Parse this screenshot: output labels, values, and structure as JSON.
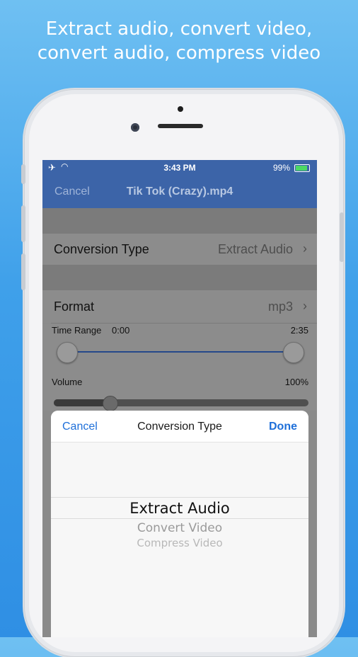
{
  "headline": {
    "line1": "Extract audio, convert video,",
    "line2": "convert audio, compress video"
  },
  "status_bar": {
    "time": "3:43 PM",
    "battery": "99%",
    "icons": [
      "airplane-icon",
      "wifi-icon",
      "battery-icon",
      "charging-icon"
    ]
  },
  "nav": {
    "cancel": "Cancel",
    "title": "Tik Tok (Crazy).mp4"
  },
  "settings": {
    "conversion_type": {
      "label": "Conversion Type",
      "value": "Extract Audio"
    },
    "format": {
      "label": "Format",
      "value": "mp3"
    },
    "time_range": {
      "label": "Time Range",
      "start": "0:00",
      "end": "2:35"
    },
    "volume": {
      "label": "Volume",
      "value": "100%",
      "level": 0.22
    }
  },
  "picker": {
    "cancel": "Cancel",
    "title": "Conversion Type",
    "done": "Done",
    "options": [
      "Extract Audio",
      "Convert Video",
      "Compress Video"
    ],
    "selected_index": 0
  },
  "colors": {
    "navbar": "#3c64a8",
    "accent": "#1e6fd9",
    "background_top": "#6fc0f2",
    "background_bottom": "#2f8fe4"
  }
}
